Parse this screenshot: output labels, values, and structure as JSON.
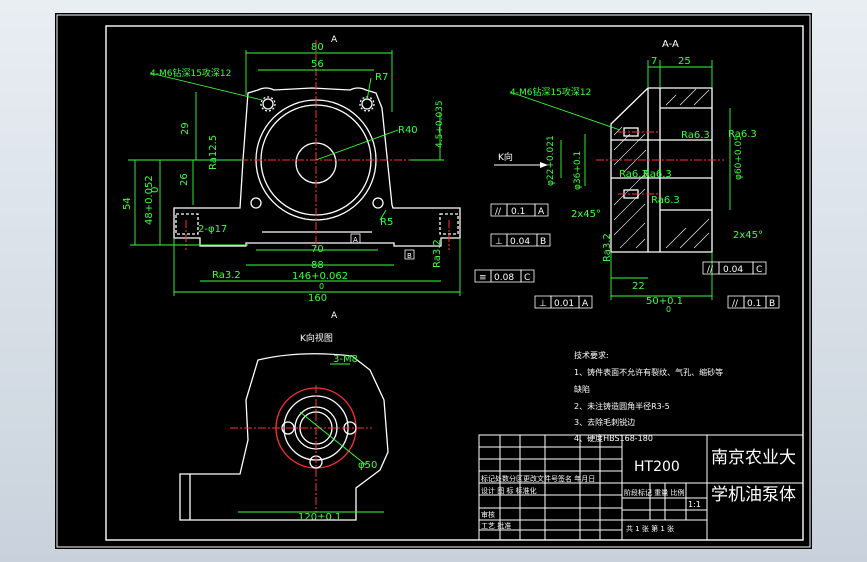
{
  "drawing": {
    "section_label": "A-A",
    "section_marker": "A",
    "k_view_label": "K向视图",
    "k_arrow_label": "K向",
    "note_holes_front": "4-M6钻深15攻深12",
    "note_holes_section": "4-M6钻深15攻深12",
    "front_dims": {
      "d80": "80",
      "d56": "56",
      "r7": "R7",
      "r40": "R40",
      "d4_5": "4.5+0.035",
      "d29": "29",
      "ra2_5": "Ra12.5",
      "d26": "26",
      "d48": "48+0.052",
      "d48_0": "0",
      "d54": "54",
      "phi17": "2-φ17",
      "r5": "R5",
      "d70": "70",
      "d88": "88",
      "d146": "146+0.062",
      "d146_0": "0",
      "d160": "160",
      "ra3_2": "Ra3.2",
      "ra3_2b": "Ra3.2",
      "d35": "35"
    },
    "front_tolerances": {
      "par": "//",
      "par_val": "0.1",
      "par_ref": "A",
      "perp": "⊥",
      "perp_val": "0.04",
      "perp_ref": "B",
      "sym": "≡",
      "sym_val": "0.08",
      "sym_ref": "C",
      "datum_a": "A",
      "datum_b": "B",
      "datum_c": "C"
    },
    "section_dims": {
      "d7": "7",
      "d25": "25",
      "phi22": "φ22+0.021",
      "phi22_0": "0",
      "phi36": "φ36+0.1",
      "phi36_0": "0",
      "phi60": "φ60+0.05",
      "phi60_0": "0",
      "ra6_3a": "Ra6.3",
      "ra6_3b": "Ra6.3",
      "ra6_3c": "Ra6.3",
      "ra6_3d": "Ra6.3",
      "ch2x45a": "2x45°",
      "ch2x45b": "2x45°",
      "ra3_2": "Ra3.2",
      "d22": "22",
      "d50": "50+0.1",
      "d50_0": "0",
      "par_top": "//",
      "par_top_val": "0.1",
      "par_top_ref": "A",
      "perp_top": "⊥",
      "perp_top_val": "0.04",
      "perp_top_ref": "B",
      "perp_bot": "⊥",
      "perp_bot_val": "0.01",
      "perp_bot_ref": "A",
      "par_bot": "//",
      "par_bot_val": "0.1",
      "par_bot_ref": "B",
      "par_r": "//",
      "par_r_val": "0.04",
      "par_r_ref": "C",
      "ra6_3e": "Ra6.3",
      "ra6_3f": "Ra6.3"
    },
    "bottom_dims": {
      "thread": "3-M8",
      "phi50": "φ50",
      "d120": "120±0.1"
    },
    "tech": {
      "title": "技术要求:",
      "l1": "1、铸件表面不允许有裂纹、气孔、缩砂等",
      "l1b": "缺陷",
      "l2": "2、未注铸造圆角半径R3-5",
      "l3": "3、去除毛刺锐边",
      "l4": "4、硬度HBS168-180"
    },
    "title_block": {
      "material": "HT200",
      "company_l1": "南京农业大",
      "company_l2": "学机油泵体",
      "row_revision": "标记处数分区更改文件号签名 年月日",
      "row_design": "设计 图 标 标准化",
      "row_stage": "阶段标记 重量 比例",
      "scale": "1:1",
      "row_check": "审核",
      "row_process": "工艺 批准",
      "row_sheets": "共 1 张  第 1 张"
    }
  }
}
